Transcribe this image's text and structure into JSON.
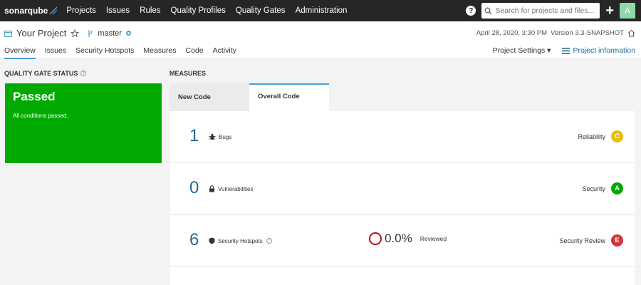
{
  "topbar": {
    "logo": "sonarqube",
    "nav": [
      "Projects",
      "Issues",
      "Rules",
      "Quality Profiles",
      "Quality Gates",
      "Administration"
    ],
    "help_icon": "?",
    "search_placeholder": "Search for projects and files...",
    "plus_icon": "+",
    "avatar_letter": "A"
  },
  "project": {
    "name": "Your Project",
    "branch": "master",
    "date": "April 28, 2020, 3:30 PM",
    "version": "Version 3.3-SNAPSHOT",
    "tabs": [
      "Overview",
      "Issues",
      "Security Hotspots",
      "Measures",
      "Code",
      "Activity"
    ],
    "active_tab": "Overview",
    "settings_label": "Project Settings",
    "info_label": "Project information"
  },
  "quality_gate": {
    "label": "QUALITY GATE STATUS",
    "status": "Passed",
    "message": "All conditions passed.",
    "color": "#00aa00"
  },
  "measures": {
    "label": "MEASURES",
    "tabs": [
      "New Code",
      "Overall Code"
    ],
    "active_tab": "Overall Code",
    "rows": [
      {
        "value": "1",
        "name": "Bugs",
        "icon": "bug-icon",
        "rating_label": "Reliability",
        "rating": "C",
        "rating_color": "#eabe06"
      },
      {
        "value": "0",
        "name": "Vulnerabilities",
        "icon": "lock-icon",
        "rating_label": "Security",
        "rating": "A",
        "rating_color": "#00aa00"
      },
      {
        "value": "6",
        "name": "Security Hotspots",
        "icon": "shield-icon",
        "rating_label": "Security Review",
        "rating": "E",
        "rating_color": "#d4333f",
        "reviewed_pct": "0.0%",
        "reviewed_label": "Reviewed"
      }
    ]
  }
}
